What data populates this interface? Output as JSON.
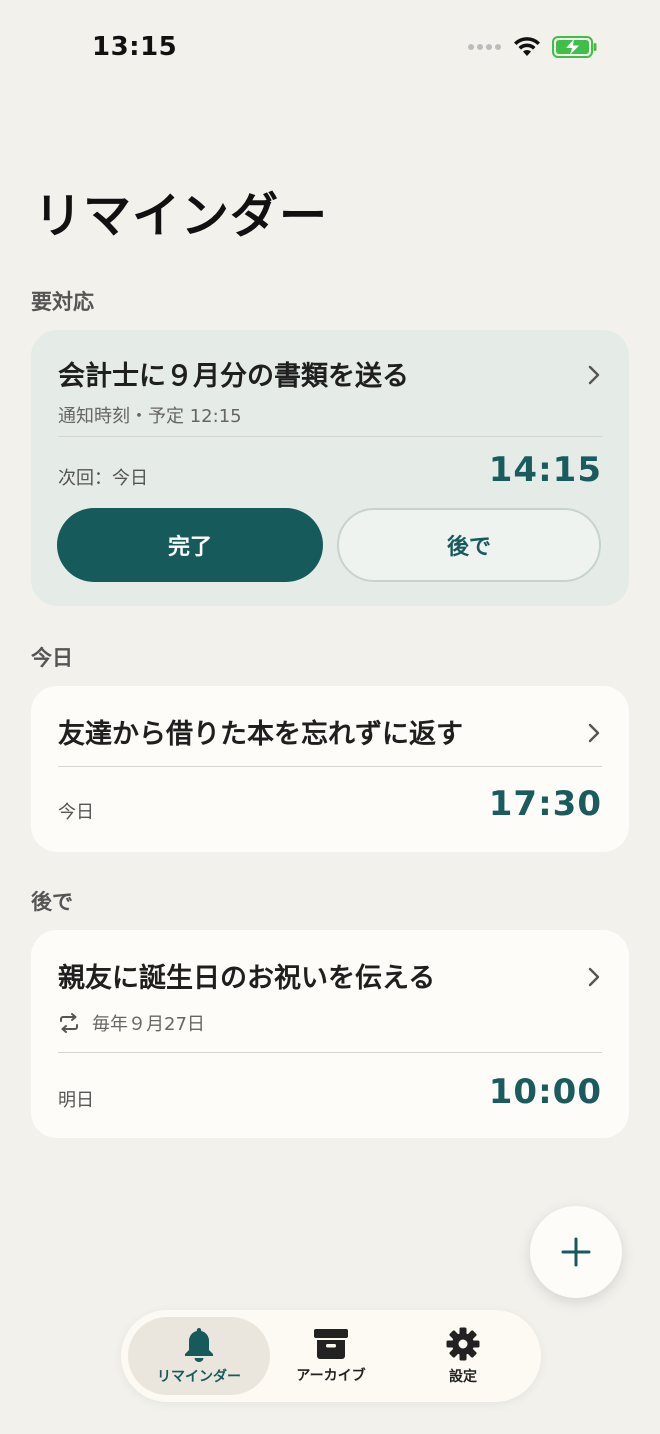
{
  "status_bar": {
    "time": "13:15"
  },
  "page": {
    "title": "リマインダー"
  },
  "sections": {
    "urgent": {
      "title": "要対応",
      "card": {
        "title": "会計士に９月分の書類を送る",
        "subtitle": "通知時刻・予定 12:15",
        "next_label": "次回：今日",
        "time": "14:15",
        "done_label": "完了",
        "later_label": "後で"
      }
    },
    "today": {
      "title": "今日",
      "card": {
        "title": "友達から借りた本を忘れずに返す",
        "day_label": "今日",
        "time": "17:30"
      }
    },
    "later": {
      "title": "後で",
      "card": {
        "title": "親友に誕生日のお祝いを伝える",
        "repeat": "毎年９月27日",
        "day_label": "明日",
        "time": "10:00"
      }
    }
  },
  "tabs": [
    {
      "label": "リマインダー",
      "icon": "bell-icon",
      "active": true
    },
    {
      "label": "アーカイブ",
      "icon": "archive-icon",
      "active": false
    },
    {
      "label": "設定",
      "icon": "gear-icon",
      "active": false
    }
  ],
  "colors": {
    "accent": "#175a5b",
    "background": "#f3f1ec",
    "urgent_card": "#e5ece8",
    "card": "#fdfcf8"
  }
}
